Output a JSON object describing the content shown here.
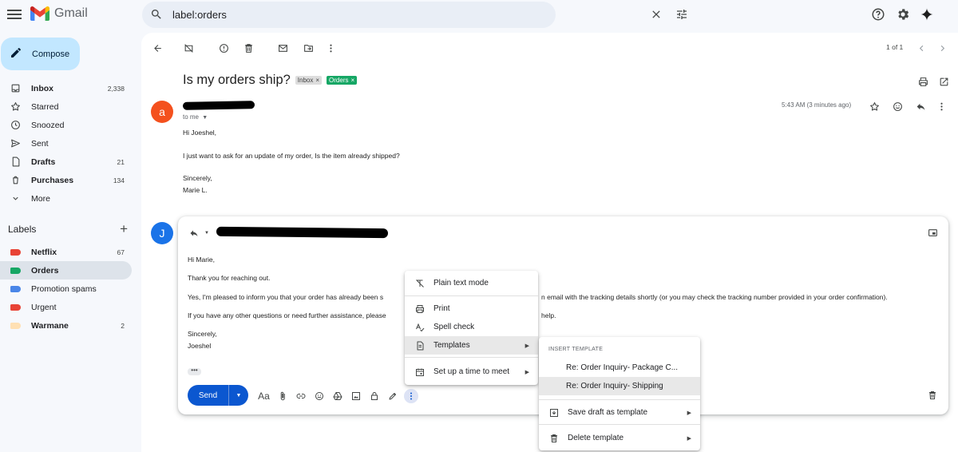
{
  "app": {
    "name": "Gmail"
  },
  "search": {
    "value": "label:orders"
  },
  "compose": {
    "label": "Compose"
  },
  "nav": [
    {
      "name": "inbox",
      "label": "Inbox",
      "count": "2,338",
      "bold": true,
      "icon": "inbox-icon"
    },
    {
      "name": "starred",
      "label": "Starred",
      "count": "",
      "bold": false,
      "icon": "star-icon"
    },
    {
      "name": "snoozed",
      "label": "Snoozed",
      "count": "",
      "bold": false,
      "icon": "clock-icon"
    },
    {
      "name": "sent",
      "label": "Sent",
      "count": "",
      "bold": false,
      "icon": "send-icon"
    },
    {
      "name": "drafts",
      "label": "Drafts",
      "count": "21",
      "bold": true,
      "icon": "draft-icon"
    },
    {
      "name": "purchases",
      "label": "Purchases",
      "count": "134",
      "bold": true,
      "icon": "tag-icon"
    },
    {
      "name": "more",
      "label": "More",
      "count": "",
      "bold": false,
      "icon": "chevron-down-icon"
    }
  ],
  "labels": {
    "heading": "Labels",
    "items": [
      {
        "name": "netflix",
        "label": "Netflix",
        "count": "67",
        "bold": true,
        "color": "#e84336"
      },
      {
        "name": "orders",
        "label": "Orders",
        "count": "",
        "bold": true,
        "color": "#16a765",
        "active": true
      },
      {
        "name": "promotion-spams",
        "label": "Promotion spams",
        "count": "",
        "bold": false,
        "color": "#4a86e8"
      },
      {
        "name": "urgent",
        "label": "Urgent",
        "count": "",
        "bold": false,
        "color": "#e84336"
      },
      {
        "name": "warmane",
        "label": "Warmane",
        "count": "2",
        "bold": true,
        "color": "#ffe0b3"
      }
    ]
  },
  "toolbar": {
    "pager": "1 of 1"
  },
  "thread": {
    "subject": "Is my orders ship?",
    "chips": {
      "inbox": "Inbox",
      "orders": "Orders"
    },
    "message": {
      "avatar_letter": "a",
      "avatar_color": "#f4511e",
      "to": "to me",
      "time": "5:43 AM (3 minutes ago)",
      "lines": [
        "Hi Joeshel,",
        "I just want to ask for an update of my order, Is the item already shipped?",
        "Sincerely,",
        "Marie L."
      ]
    }
  },
  "reply": {
    "avatar_letter": "J",
    "avatar_color": "#1a73e8",
    "lines": [
      "Hi Marie,",
      "Thank you for reaching out.",
      "Yes, I'm pleased to inform you that your order has already been s",
      "n email with the tracking details shortly (or you may check the tracking number provided in your order confirmation).",
      "If you have any other questions or need further assistance, please",
      "help.",
      "Sincerely,",
      "Joeshel"
    ],
    "send_label": "Send",
    "format_label": "Aa"
  },
  "more_menu": {
    "items": [
      {
        "name": "plain-text-mode",
        "label": "Plain text mode",
        "icon": "plain-text-icon"
      },
      {
        "name": "print",
        "label": "Print",
        "icon": "print-icon"
      },
      {
        "name": "spell-check",
        "label": "Spell check",
        "icon": "spell-check-icon"
      },
      {
        "name": "templates",
        "label": "Templates",
        "icon": "templates-icon",
        "submenu": true,
        "highlighted": true
      },
      {
        "name": "set-up-time",
        "label": "Set up a time to meet",
        "icon": "calendar-icon",
        "submenu": true
      }
    ]
  },
  "templates_menu": {
    "heading": "INSERT TEMPLATE",
    "templates": [
      "Re: Order Inquiry- Package C...",
      "Re: Order Inquiry- Shipping"
    ],
    "save_label": "Save draft as template",
    "delete_label": "Delete template"
  }
}
